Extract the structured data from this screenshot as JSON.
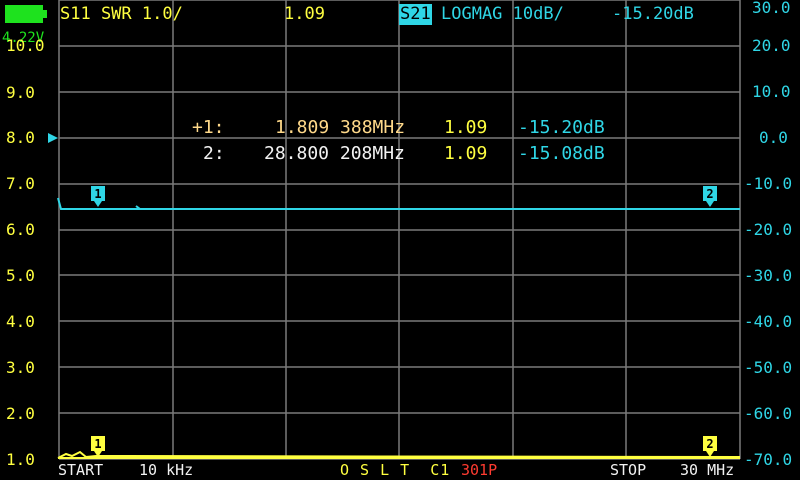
{
  "header": {
    "trace1_label": "S11 SWR 1.0/",
    "trace1_value": "1.09",
    "trace2_channel": "S21",
    "trace2_label": "LOGMAG 10dB/",
    "trace2_value": "-15.20dB"
  },
  "battery": {
    "voltage": "4.22V",
    "level": 1.0
  },
  "left_axis": [
    "10.0",
    "9.0",
    "8.0",
    "7.0",
    "6.0",
    "5.0",
    "4.0",
    "3.0",
    "2.0",
    "1.0"
  ],
  "right_axis": [
    "30.0",
    "20.0",
    "10.0",
    "0.0",
    "-10.0",
    "-20.0",
    "-30.0",
    "-40.0",
    "-50.0",
    "-60.0",
    "-70.0"
  ],
  "markers": [
    {
      "prefix": "+1:",
      "freq": "1.809 388MHz",
      "swr": "1.09",
      "logmag": "-15.20dB"
    },
    {
      "prefix": "2:",
      "freq": "28.800 208MHz",
      "swr": "1.09",
      "logmag": "-15.08dB"
    }
  ],
  "trace_markers": {
    "cyan": [
      "1",
      "2"
    ],
    "yellow": [
      "1",
      "2"
    ]
  },
  "footer": {
    "start_label": "START",
    "start_value": "10 kHz",
    "cal_status": "O S L T  C1",
    "points": "301P",
    "stop_label": "STOP",
    "stop_value": "30 MHz"
  },
  "colors": {
    "trace1": "#ffff40",
    "trace2": "#2fd6e6",
    "grid": "#7a7a7a",
    "points": "#ff3b30"
  },
  "chart_data": {
    "type": "line",
    "x_start": "10 kHz",
    "x_stop": "30 MHz",
    "series": [
      {
        "name": "S11 SWR",
        "scale": "1.0/",
        "values_summary": [
          1.09,
          1.09
        ]
      },
      {
        "name": "S21 LOGMAG",
        "scale": "10dB/",
        "values_summary": [
          -15.2,
          -15.08
        ]
      }
    ]
  }
}
